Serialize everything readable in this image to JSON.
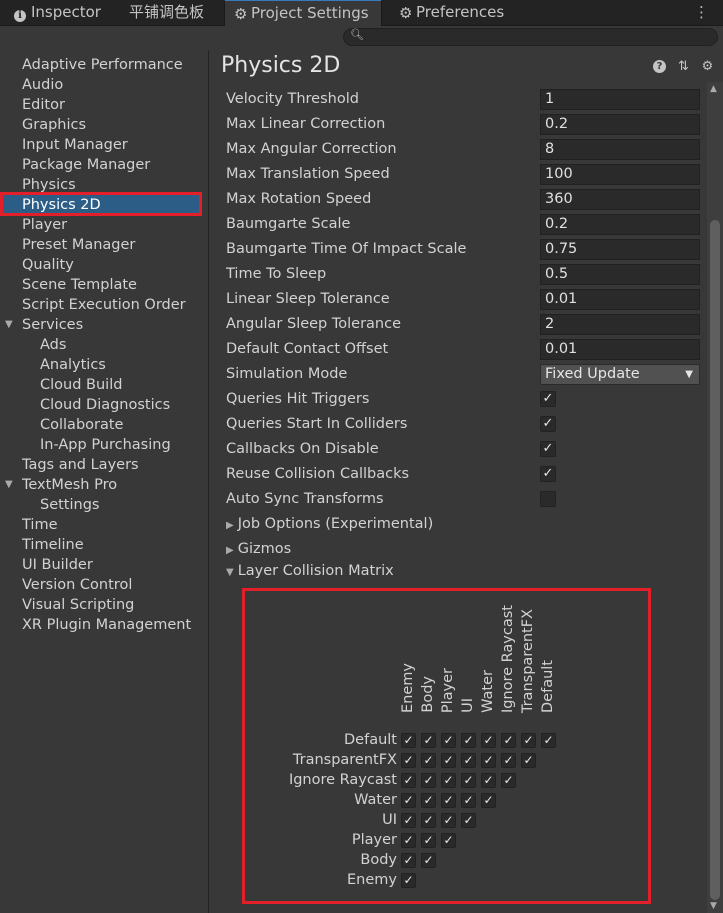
{
  "tabs": [
    {
      "label": "Inspector",
      "icon": "info-icon"
    },
    {
      "label": "平铺调色板",
      "icon": ""
    },
    {
      "label": "Project Settings",
      "icon": "gear-icon"
    },
    {
      "label": "Preferences",
      "icon": "gear-icon"
    }
  ],
  "search": {
    "placeholder": ""
  },
  "sidebar": {
    "items": [
      {
        "label": "Adaptive Performance",
        "level": 0
      },
      {
        "label": "Audio",
        "level": 0
      },
      {
        "label": "Editor",
        "level": 0
      },
      {
        "label": "Graphics",
        "level": 0
      },
      {
        "label": "Input Manager",
        "level": 0
      },
      {
        "label": "Package Manager",
        "level": 0
      },
      {
        "label": "Physics",
        "level": 0
      },
      {
        "label": "Physics 2D",
        "level": 0,
        "selected": true
      },
      {
        "label": "Player",
        "level": 0
      },
      {
        "label": "Preset Manager",
        "level": 0
      },
      {
        "label": "Quality",
        "level": 0
      },
      {
        "label": "Scene Template",
        "level": 0
      },
      {
        "label": "Script Execution Order",
        "level": 0
      },
      {
        "label": "Services",
        "level": 0,
        "expanded": true
      },
      {
        "label": "Ads",
        "level": 1
      },
      {
        "label": "Analytics",
        "level": 1
      },
      {
        "label": "Cloud Build",
        "level": 1
      },
      {
        "label": "Cloud Diagnostics",
        "level": 1
      },
      {
        "label": "Collaborate",
        "level": 1
      },
      {
        "label": "In-App Purchasing",
        "level": 1
      },
      {
        "label": "Tags and Layers",
        "level": 0
      },
      {
        "label": "TextMesh Pro",
        "level": 0,
        "expanded": true
      },
      {
        "label": "Settings",
        "level": 1
      },
      {
        "label": "Time",
        "level": 0
      },
      {
        "label": "Timeline",
        "level": 0
      },
      {
        "label": "UI Builder",
        "level": 0
      },
      {
        "label": "Version Control",
        "level": 0
      },
      {
        "label": "Visual Scripting",
        "level": 0
      },
      {
        "label": "XR Plugin Management",
        "level": 0
      }
    ]
  },
  "main": {
    "title": "Physics 2D",
    "header_icons": [
      "help-icon",
      "preset-icon",
      "settings-icon"
    ],
    "fields": [
      {
        "label": "Velocity Threshold",
        "value": "1"
      },
      {
        "label": "Max Linear Correction",
        "value": "0.2"
      },
      {
        "label": "Max Angular Correction",
        "value": "8"
      },
      {
        "label": "Max Translation Speed",
        "value": "100"
      },
      {
        "label": "Max Rotation Speed",
        "value": "360"
      },
      {
        "label": "Baumgarte Scale",
        "value": "0.2"
      },
      {
        "label": "Baumgarte Time Of Impact Scale",
        "value": "0.75"
      },
      {
        "label": "Time To Sleep",
        "value": "0.5"
      },
      {
        "label": "Linear Sleep Tolerance",
        "value": "0.01"
      },
      {
        "label": "Angular Sleep Tolerance",
        "value": "2"
      },
      {
        "label": "Default Contact Offset",
        "value": "0.01"
      }
    ],
    "simulation_mode": {
      "label": "Simulation Mode",
      "value": "Fixed Update"
    },
    "toggles": [
      {
        "label": "Queries Hit Triggers",
        "checked": true
      },
      {
        "label": "Queries Start In Colliders",
        "checked": true
      },
      {
        "label": "Callbacks On Disable",
        "checked": true
      },
      {
        "label": "Reuse Collision Callbacks",
        "checked": true
      },
      {
        "label": "Auto Sync Transforms",
        "checked": false
      }
    ],
    "foldouts": [
      {
        "label": "Job Options (Experimental)",
        "expanded": false
      },
      {
        "label": "Gizmos",
        "expanded": false
      },
      {
        "label": "Layer Collision Matrix",
        "expanded": true
      }
    ],
    "collision_matrix": {
      "layers": [
        "Default",
        "TransparentFX",
        "Ignore Raycast",
        "Water",
        "UI",
        "Player",
        "Body",
        "Enemy"
      ],
      "columns": [
        "Enemy",
        "Body",
        "Player",
        "UI",
        "Water",
        "Ignore Raycast",
        "TransparentFX",
        "Default"
      ],
      "all_checked": true
    }
  }
}
